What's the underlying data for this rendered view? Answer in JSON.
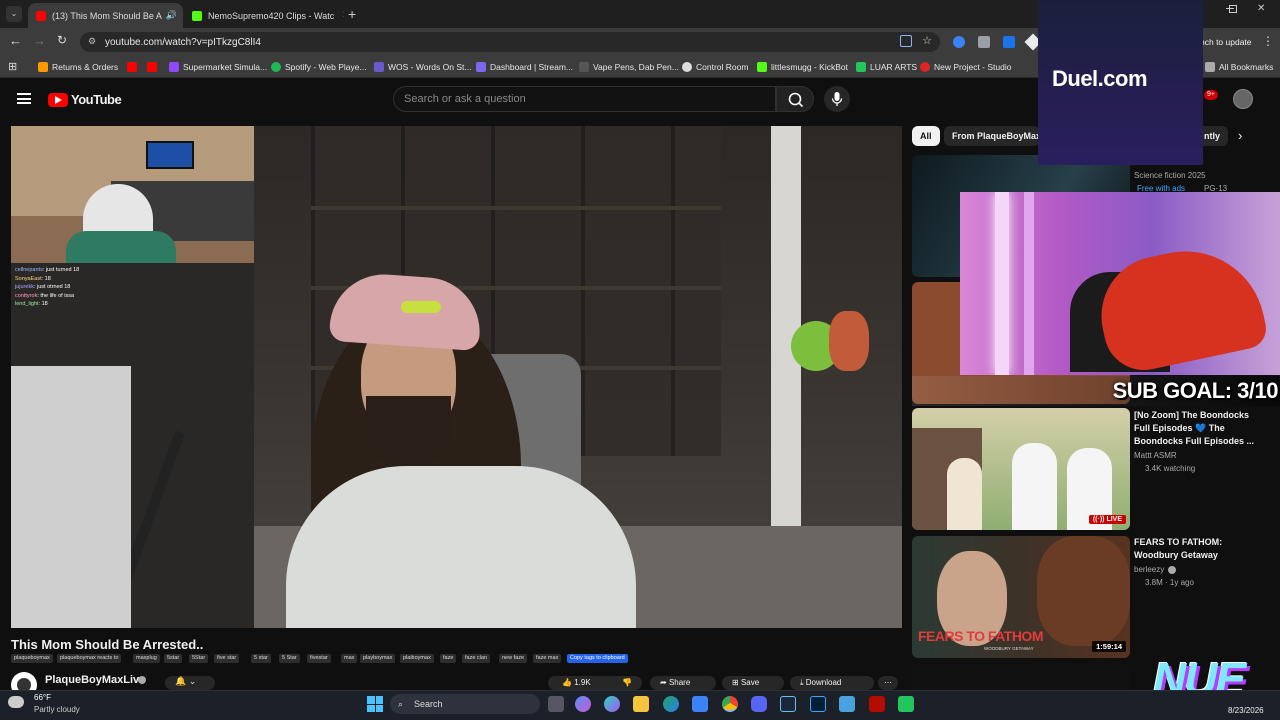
{
  "browser": {
    "tabs": [
      {
        "title": "(13) This Mom Should Be A",
        "active": true
      },
      {
        "title": "NemoSupremo420 Clips - Watc",
        "active": false
      }
    ],
    "url": "youtube.com/watch?v=pITkzgC8lI4",
    "relaunch_label": "nch to update",
    "bookmarks": [
      "Returns & Orders",
      "Supermarket Simula...",
      "Spotify - Web Playe...",
      "WOS - Words On St...",
      "Dashboard | Stream...",
      "Vape Pens, Dab Pen...",
      "Control Room",
      "littlesmugg - KickBot",
      "LUAR ARTS",
      "New Project - Studio"
    ],
    "all_bookmarks": "All Bookmarks"
  },
  "youtube": {
    "logo_text": "YouTube",
    "search_placeholder": "Search or ask a question",
    "notif_count": "9+"
  },
  "video": {
    "title": "This Mom Should Be Arrested..",
    "tags": [
      "plaqueboymax",
      "plaqueboymax reacts to",
      "maxplug",
      "5star",
      "5Star",
      "five star",
      "5 star",
      "5 Star",
      "fivestar",
      "max",
      "playboymax",
      "plaiboymax",
      "faze",
      "faze clan",
      "new faze",
      "faze max"
    ],
    "copy_tags": "Copy tags to clipboard",
    "channel": "PlaqueBoyMaxLive",
    "like_count": "1.9K",
    "share_label": "Share",
    "save_label": "Save",
    "download_label": "Download",
    "chat": [
      {
        "user": "cellnepants",
        "msg": "just turned 18"
      },
      {
        "user": "SonyaEast",
        "msg": "18"
      },
      {
        "user": "jujurekk",
        "msg": "just otrned 18"
      },
      {
        "user": "conttyrok",
        "msg": "the life of issa"
      },
      {
        "user": "lend_light",
        "msg": "18"
      }
    ]
  },
  "sidebar": {
    "chips": [
      "All",
      "From PlaqueBoyMax",
      "ntly"
    ],
    "items": [
      {
        "meta1": "Science fiction 2025",
        "meta2": "Free with ads",
        "rating": "PG-13"
      },
      {
        "title": "[No Zoom] The Boondocks Full Episodes 💙 The Boondocks Full Episodes ...",
        "channel": "Mattt ASMR",
        "stats": "3.4K watching",
        "badge": "LIVE"
      },
      {
        "title": "FEARS TO FATHOM: Woodbury Getaway",
        "channel": "berleezy",
        "stats": "3.8M · 1y ago",
        "duration": "1:59:14",
        "thumb_text": "FEARS TO FATHOM",
        "thumb_sub": "WOODBURY GETAWAY"
      }
    ]
  },
  "overlays": {
    "duel": "Duel.com",
    "sub_goal": "SUB GOAL: 3/10",
    "nue": "NUE"
  },
  "taskbar": {
    "temp": "66°F",
    "weather": "Partly cloudy",
    "search": "Search",
    "date": "8/23/2026"
  }
}
